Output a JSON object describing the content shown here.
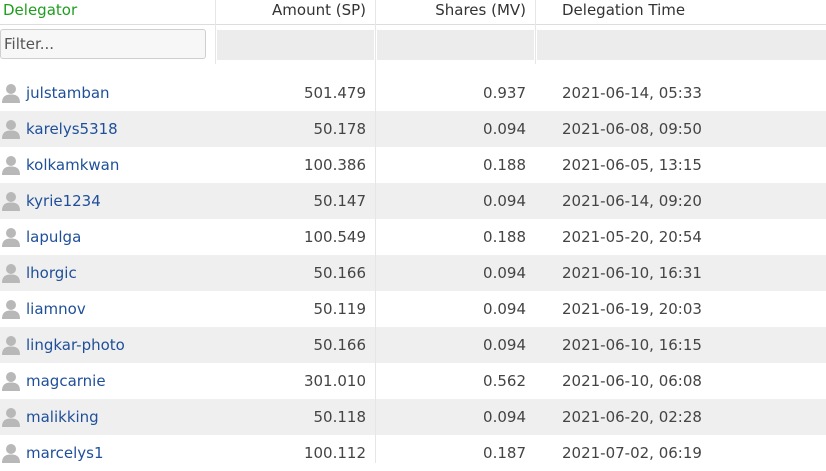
{
  "columns": {
    "delegator": "Delegator",
    "amount": "Amount (SP)",
    "shares": "Shares (MV)",
    "time": "Delegation Time"
  },
  "filter": {
    "placeholder": "Filter..."
  },
  "icons": {
    "user": "user-icon"
  },
  "colors": {
    "header_accent": "#1e9e1e",
    "link": "#1f4f9a",
    "row_alt": "#efefef"
  },
  "rows": [
    {
      "user": "julstamban",
      "amount": "501.479",
      "shares": "0.937",
      "time": "2021-06-14, 05:33"
    },
    {
      "user": "karelys5318",
      "amount": "50.178",
      "shares": "0.094",
      "time": "2021-06-08, 09:50"
    },
    {
      "user": "kolkamkwan",
      "amount": "100.386",
      "shares": "0.188",
      "time": "2021-06-05, 13:15"
    },
    {
      "user": "kyrie1234",
      "amount": "50.147",
      "shares": "0.094",
      "time": "2021-06-14, 09:20"
    },
    {
      "user": "lapulga",
      "amount": "100.549",
      "shares": "0.188",
      "time": "2021-05-20, 20:54"
    },
    {
      "user": "lhorgic",
      "amount": "50.166",
      "shares": "0.094",
      "time": "2021-06-10, 16:31"
    },
    {
      "user": "liamnov",
      "amount": "50.119",
      "shares": "0.094",
      "time": "2021-06-19, 20:03"
    },
    {
      "user": "lingkar-photo",
      "amount": "50.166",
      "shares": "0.094",
      "time": "2021-06-10, 16:15"
    },
    {
      "user": "magcarnie",
      "amount": "301.010",
      "shares": "0.562",
      "time": "2021-06-10, 06:08"
    },
    {
      "user": "malikking",
      "amount": "50.118",
      "shares": "0.094",
      "time": "2021-06-20, 02:28"
    },
    {
      "user": "marcelys1",
      "amount": "100.112",
      "shares": "0.187",
      "time": "2021-07-02, 06:19"
    }
  ]
}
